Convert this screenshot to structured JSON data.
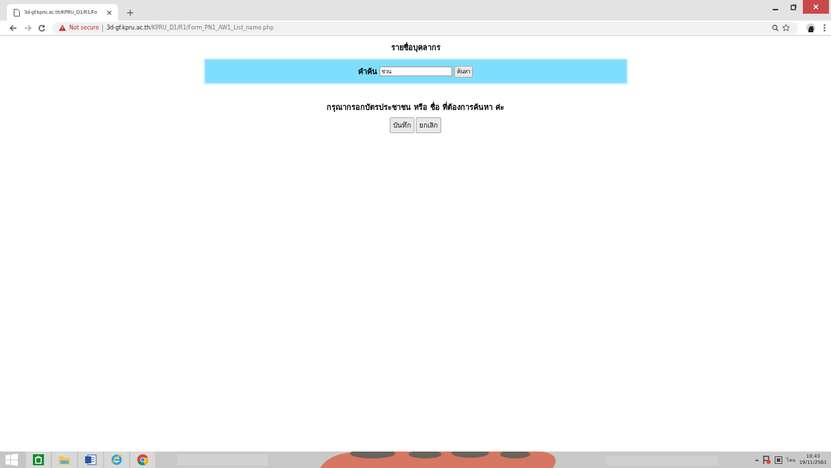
{
  "browser": {
    "tab": {
      "title": "3d-gf.kpru.ac.th/KPRU_D1/R1/Fo",
      "close": "×",
      "selected": true
    },
    "new_tab": "+",
    "security": "Not secure",
    "url_host": "3d-gf.kpru.ac.th",
    "url_path": "/KPRU_D1/R1/Form_PN1_AW1_List_name.php"
  },
  "page": {
    "title": "รายชื่อบุคลากร",
    "search": {
      "label": "คำค้น",
      "value": "ชวน",
      "button": "ค้นหา"
    },
    "message": "กรุณากรอกบัตรประชาชน หรือ ชื่อ ที่ต้องการค้นหา ค่ะ",
    "buttons": [
      "บันทึก",
      "ยกเลิก"
    ]
  },
  "taskbar": {
    "apps": [
      {
        "kind": "store"
      },
      {
        "kind": "folder"
      },
      {
        "kind": "word"
      },
      {
        "kind": "ie"
      },
      {
        "kind": "chrome"
      }
    ],
    "language": "ไทย",
    "time": "10:43",
    "date": "19/11/2561"
  }
}
